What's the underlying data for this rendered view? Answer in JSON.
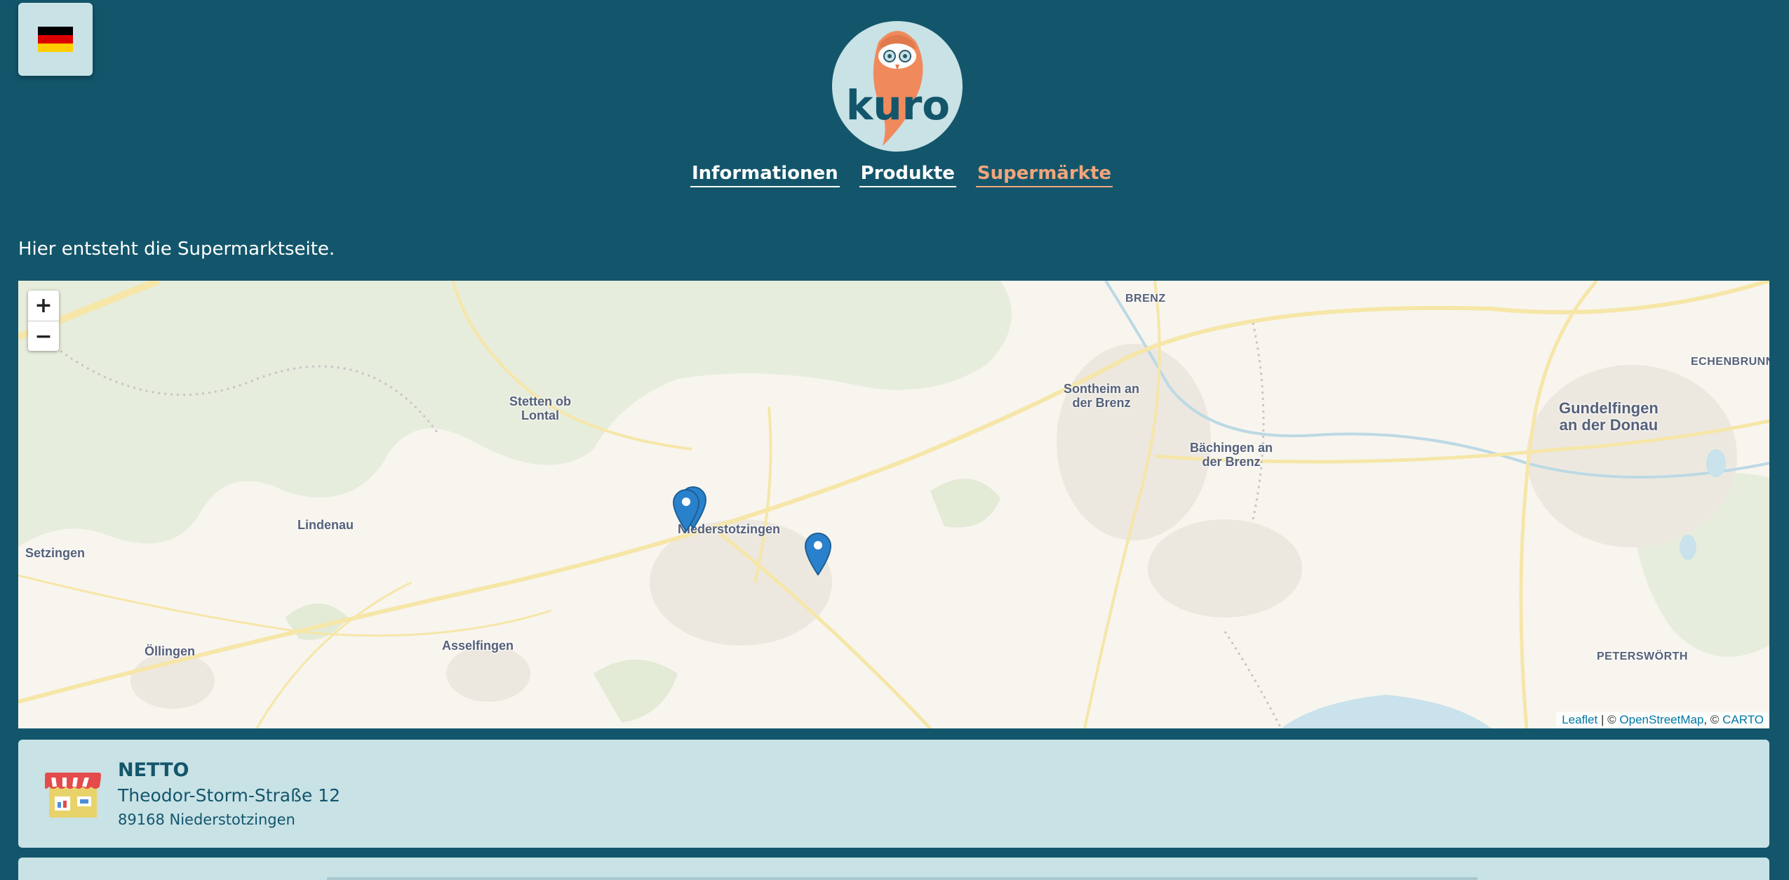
{
  "language": {
    "current": "de",
    "flag_colors": [
      "#000000",
      "#dd0000",
      "#ffce00"
    ]
  },
  "brand": {
    "name": "kuro",
    "accent": "#f2a57c",
    "background": "#13566b"
  },
  "nav": {
    "items": [
      {
        "label": "Informationen",
        "active": false
      },
      {
        "label": "Produkte",
        "active": false
      },
      {
        "label": "Supermärkte",
        "active": true
      }
    ]
  },
  "intro_text": "Hier entsteht die Supermarktseite.",
  "map": {
    "zoom_in": "+",
    "zoom_out": "−",
    "places": [
      "Stetten ob\nLontal",
      "Lindenau",
      "Setzingen",
      "Öllingen",
      "Asselfingen",
      "Niederstotzingen",
      "BRENZ",
      "Sontheim an\nder Brenz",
      "Bächingen an\nder Brenz",
      "Gundelfingen\nan der Donau",
      "ECHENBRUNN",
      "PETERSWÖRTH"
    ],
    "attribution": {
      "leaflet": "Leaflet",
      "sep1": " | © ",
      "osm": "OpenStreetMap",
      "sep2": ", © ",
      "carto": "CARTO"
    }
  },
  "supermarkets": [
    {
      "name": "NETTO",
      "street": "Theodor-Storm-Straße 12",
      "city": "89168 Niederstotzingen"
    }
  ]
}
